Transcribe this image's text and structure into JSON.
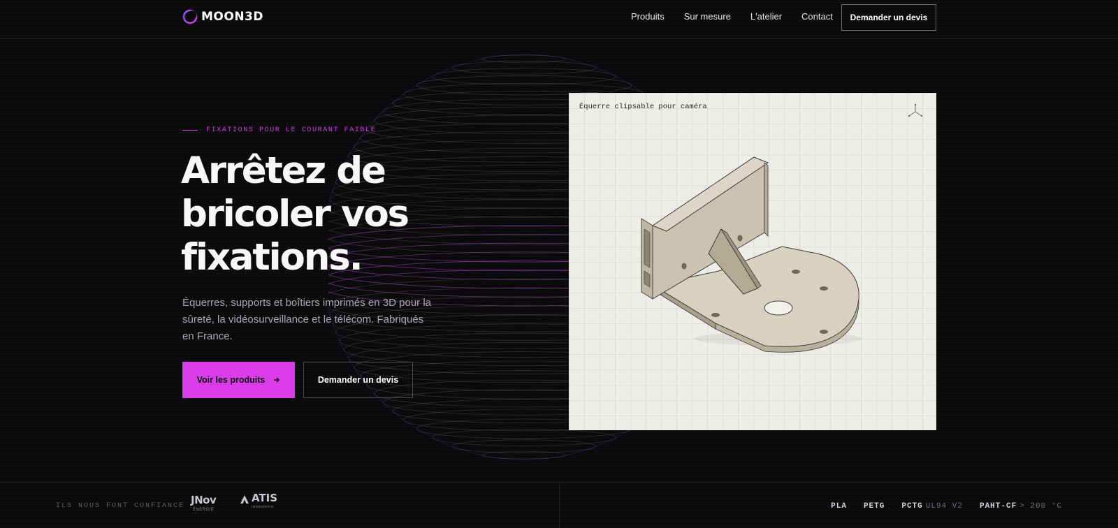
{
  "brand": {
    "name": "MOON3D",
    "accent_color": "#d93ce8"
  },
  "nav": {
    "links": [
      "Produits",
      "Sur mesure",
      "L'atelier",
      "Contact"
    ],
    "cta_label": "Demander un devis"
  },
  "hero": {
    "eyebrow": "FIXATIONS POUR LE COURANT FAIBLE",
    "headline": "Arrêtez de bricoler vos fixations.",
    "subtext": "Équerres, supports et boîtiers imprimés en 3D pour la sûreté, la vidéosurveillance et le télécom. Fabriqués en France.",
    "primary_cta": "Voir les produits",
    "primary_cta_icon": "arrow-right-icon",
    "secondary_cta": "Demander un devis"
  },
  "product_card": {
    "label": "Équerre clipsable pour caméra",
    "axis_icon": "axis-gizmo-icon"
  },
  "trust": {
    "label": "ILS NOUS FONT CONFIANCE",
    "partners": [
      {
        "name": "JNov",
        "sub": "ÉNERGIE"
      },
      {
        "name": "ATIS",
        "sub": "INGÉNIERIE"
      }
    ]
  },
  "materials": [
    {
      "name": "PLA",
      "note": ""
    },
    {
      "name": "PETG",
      "note": ""
    },
    {
      "name": "PCTG",
      "note": "UL94 V2"
    },
    {
      "name": "PAHT-CF",
      "note": "> 200 °C"
    }
  ]
}
